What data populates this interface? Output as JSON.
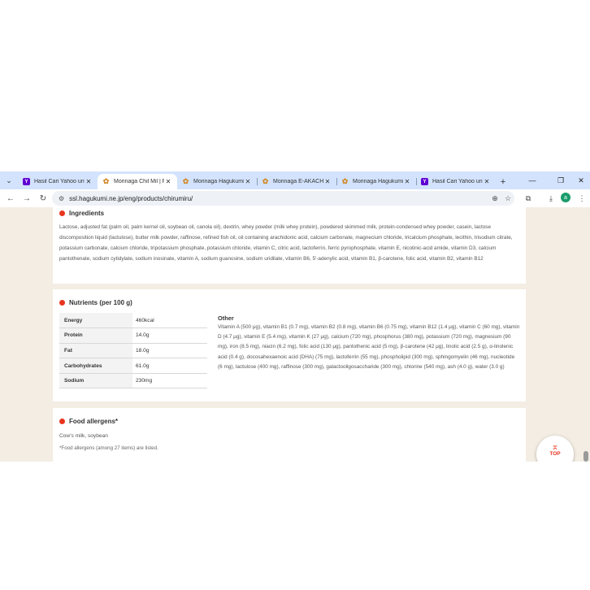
{
  "browser": {
    "tabs": [
      {
        "title": "Hasil Cari Yahoo untuk",
        "favicon": "yahoo",
        "active": false
      },
      {
        "title": "Morinaga Chil Mil | F",
        "favicon": "morinaga",
        "active": true
      },
      {
        "title": "Morinaga Hagukumi",
        "favicon": "morinaga",
        "active": false
      },
      {
        "title": "Morinaga E-AKACHA",
        "favicon": "morinaga",
        "active": false
      },
      {
        "title": "Morinaga Hagukumi",
        "favicon": "morinaga",
        "active": false
      },
      {
        "title": "Hasil Cari Yahoo untuk",
        "favicon": "yahoo",
        "active": false
      }
    ],
    "url": "ssl.hagukumi.ne.jp/eng/products/chirumiru/",
    "avatar_initial": "a"
  },
  "ingredients": {
    "title": "Ingredients",
    "text": "Lactose, adjusted fat (palm oil, palm kernel oil, soybean oil, canola oil), dextrin, whey powder (milk whey protein), powdered skimmed milk, protein-condensed whey powder, casein, lactose discomposition liquid (lactulose), butter milk powder, raffinose, refined fish oil, oil containing arachidonic acid, calcium carbonate, magnecium chloride, tricalcium phosphate, lecithin, trisodium citrate, potassium carbonate, calcium chloride, tripotassium phosphate, potassium chloride, vitamin C, citric acid, lactoferrin, ferric pyrophosphate, vitamin E, nicotinic-acid amide, vitamin D3, calcium pantothenate, sodium cytidylate, sodium inosinate, vitamin A, sodium guanosine, sodium uridilate, vitamin B6, 5'-adenylic acid, vitamin B1, β-carotene, folic acid, vitamin B2, vitamin B12"
  },
  "nutrients": {
    "title": "Nutrients (per 100 g)",
    "rows": [
      {
        "label": "Energy",
        "value": "460kcal"
      },
      {
        "label": "Protein",
        "value": "14.0g"
      },
      {
        "label": "Fat",
        "value": "18.0g"
      },
      {
        "label": "Carbohydrates",
        "value": "61.0g"
      },
      {
        "label": "Sodium",
        "value": "230mg"
      }
    ],
    "other_title": "Other",
    "other_text": "Vitamin A (500 μg), vitamin B1 (0.7 mg), vitamin B2 (0.8 mg), vitamin B6 (0.75 mg), vitamin B12 (1.4 μg), vitamin C (60 mg), vitamin D (4.7 μg), vitamin E (5.4 mg), vitamin K (27 μg), calcium (720 mg), phosphorus (380 mg), potassium (720 mg), magnesium (90 mg), iron (8.5 mg), niacin (6.2 mg), folic acid (130 μg), pantothenic acid (5 mg), β-carotene (42 μg), linolic acid (2.5 g), α-linolenic acid (0.4 g), docosahexaenoic acid (DHA) (75 mg), lactoferrin (55 mg), phospholipid (300 mg), sphingomyelin (46 mg), nucleotide (6 mg), lactulose (400 mg), raffinose (300 mg), galactooligosaccharide (300 mg), chlorine (540 mg), ash (4.0 g), water (3.0 g)"
  },
  "allergens": {
    "title": "Food allergens*",
    "text": "Cow's milk, soybean",
    "note": "*Food allergens (among 27 items) are listed."
  },
  "top_button": {
    "label": "TOP"
  },
  "colors": {
    "accent": "#e8351f",
    "page_bg": "#f3ede3",
    "tabstrip": "#d3e3fd"
  }
}
